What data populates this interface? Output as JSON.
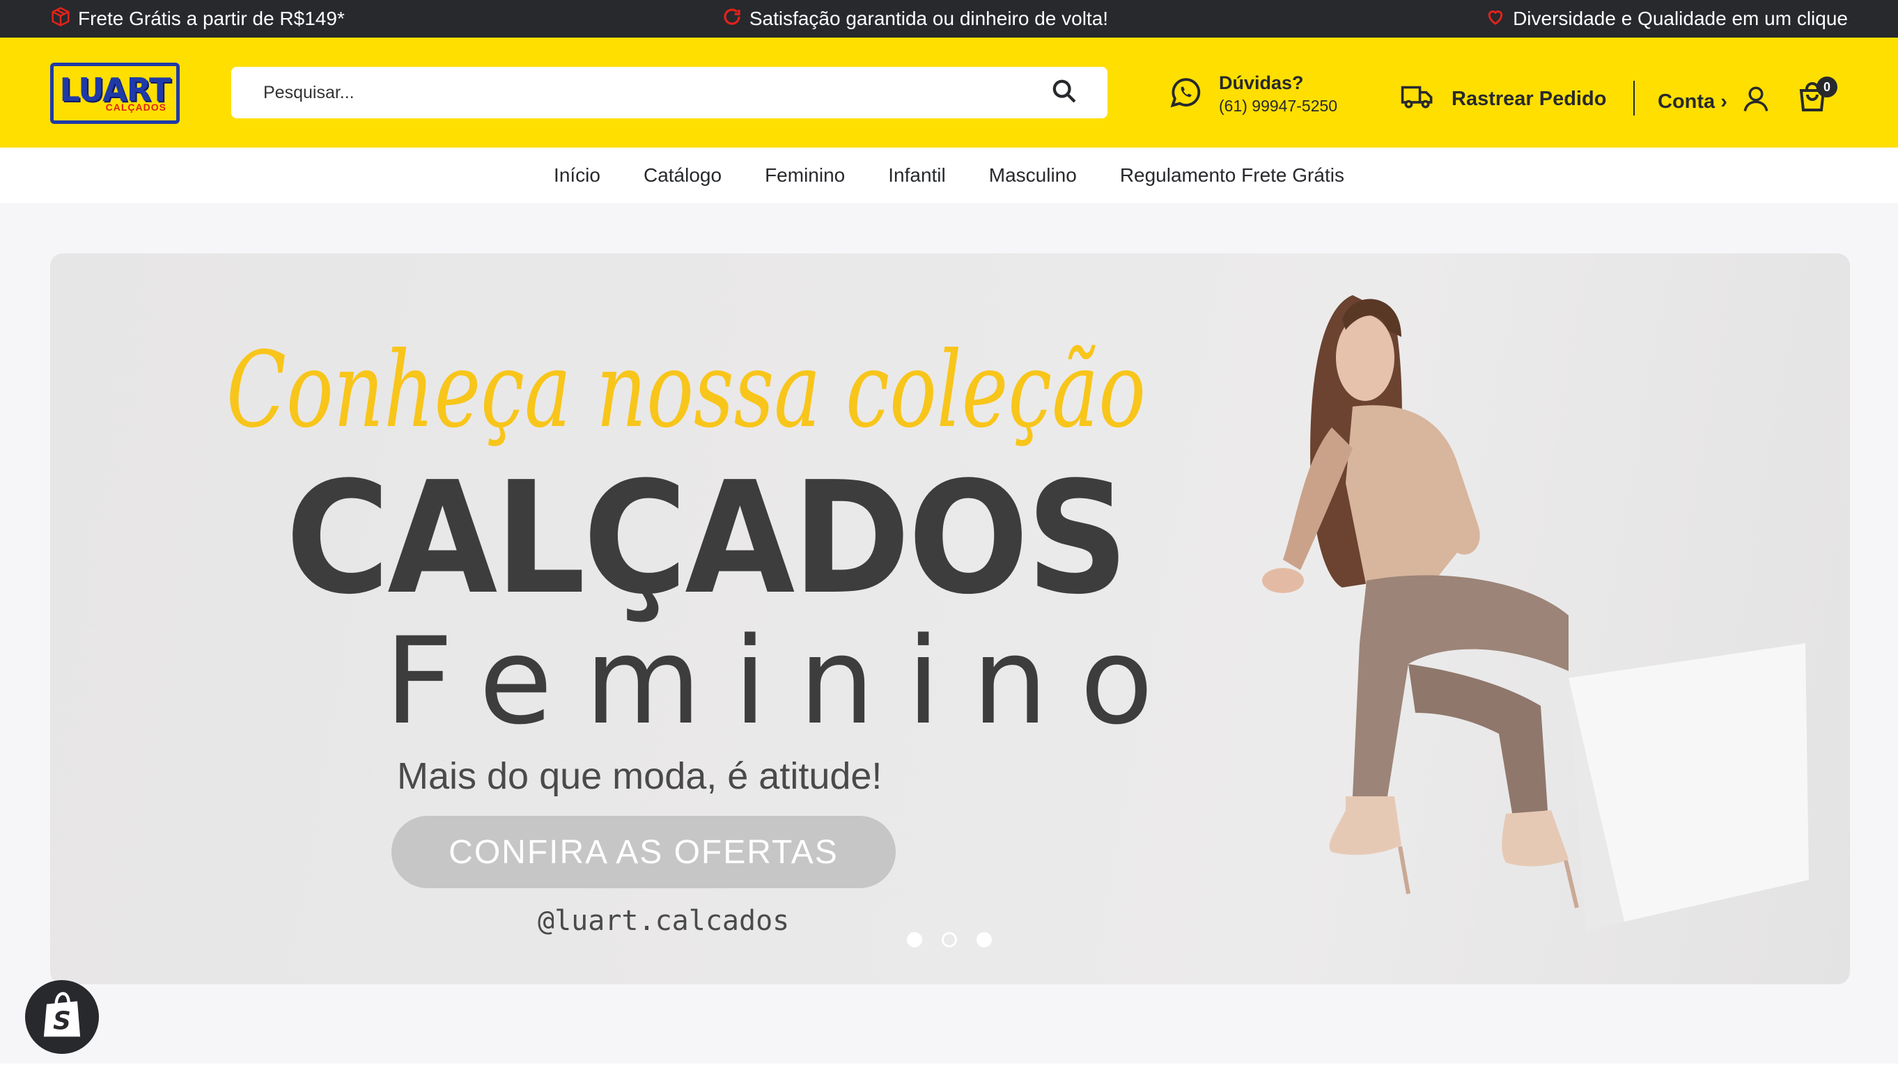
{
  "announcements": [
    {
      "icon": "box-icon",
      "text": "Frete Grátis a partir de R$149*"
    },
    {
      "icon": "refresh-icon",
      "text": "Satisfação garantida ou dinheiro de volta!"
    },
    {
      "icon": "heart-icon",
      "text": "Diversidade e Qualidade em um clique"
    }
  ],
  "header": {
    "logo": {
      "brand": "LUART",
      "sub": "CALÇADOS"
    },
    "search": {
      "placeholder": "Pesquisar..."
    },
    "help": {
      "title": "Dúvidas?",
      "phone": "(61) 99947-5250"
    },
    "track_label": "Rastrear Pedido",
    "account_label": "Conta ›",
    "cart_count": "0"
  },
  "nav": {
    "items": [
      "Início",
      "Catálogo",
      "Feminino",
      "Infantil",
      "Masculino",
      "Regulamento Frete Grátis"
    ]
  },
  "hero": {
    "script_heading": "Conheça nossa coleção",
    "headline": "CALÇADOS",
    "subheadline": "Feminino",
    "tagline": "Mais do que moda, é atitude!",
    "cta": "CONFIRA AS OFERTAS",
    "handle": "@luart.calcados",
    "slides": 3,
    "active_slide": 2
  },
  "colors": {
    "topbar": "#27292d",
    "header": "#ffdf00",
    "accent_red": "#e2231a",
    "script_yellow": "#f8c51a"
  }
}
